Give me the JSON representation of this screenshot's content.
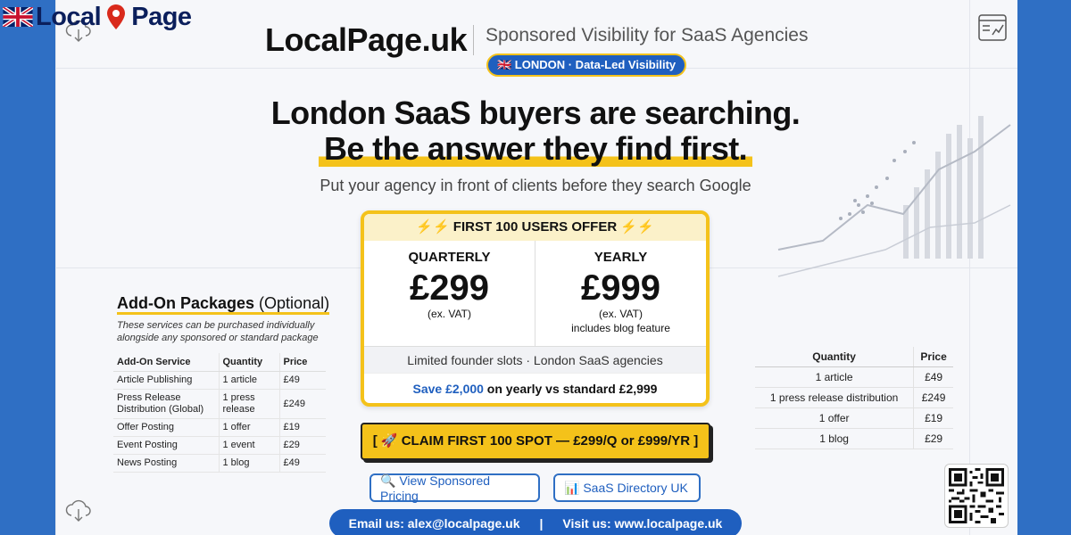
{
  "corner_logo": {
    "word1": "Local",
    "word2": "Page"
  },
  "header": {
    "brand": "LocalPage.uk",
    "tagline": "Sponsored Visibility for SaaS Agencies",
    "pill": "🇬🇧 LONDON · Data-Led Visibility"
  },
  "hero": {
    "line1": "London SaaS buyers are searching.",
    "line2": "Be the answer they find first.",
    "subtitle": "Put your agency in front of clients before they search Google"
  },
  "offer": {
    "header": "⚡⚡ FIRST 100 USERS OFFER ⚡⚡",
    "quarterly": {
      "title": "QUARTERLY",
      "price": "£299",
      "vat": "(ex. VAT)"
    },
    "yearly": {
      "title": "YEARLY",
      "price": "£999",
      "vat": "(ex. VAT)",
      "extra": "includes blog feature"
    },
    "slots": "Limited founder slots · London SaaS agencies",
    "save_blue": "Save £2,000",
    "save_rest": " on yearly vs standard £2,999"
  },
  "cta": {
    "label": "[ 🚀 CLAIM FIRST 100 SPOT — £299/Q or £999/YR ]"
  },
  "links": {
    "pricing": "🔍 View Sponsored Pricing",
    "directory": "📊 SaaS Directory UK"
  },
  "footer": {
    "email": "Email us: alex@localpage.uk",
    "sep": "|",
    "visit": "Visit us: www.localpage.uk"
  },
  "addons": {
    "title_bold": "Add-On Packages",
    "title_rest": " (Optional)",
    "note": "These services can be purchased individually alongside any sponsored or standard package",
    "headers": [
      "Add-On Service",
      "Quantity",
      "Price"
    ],
    "rows": [
      [
        "Article Publishing",
        "1 article",
        "£49"
      ],
      [
        "Press Release Distribution (Global)",
        "1 press release",
        "£249"
      ],
      [
        "Offer Posting",
        "1 offer",
        "£19"
      ],
      [
        "Event Posting",
        "1 event",
        "£29"
      ],
      [
        "News Posting",
        "1 blog",
        "£49"
      ]
    ]
  },
  "right_table": {
    "headers": [
      "Quantity",
      "Price"
    ],
    "rows": [
      [
        "1 article",
        "£49"
      ],
      [
        "1 press release distribution",
        "£249"
      ],
      [
        "1 offer",
        "£19"
      ],
      [
        "1 blog",
        "£29"
      ]
    ]
  },
  "colors": {
    "accent_yellow": "#f4c21a",
    "brand_blue": "#1f5fbf",
    "side_blue": "#2f6fc4"
  },
  "icons": [
    "uk-flag-icon",
    "location-pin-icon",
    "cloud-download-icon",
    "analytics-window-icon",
    "qr-code-icon"
  ]
}
